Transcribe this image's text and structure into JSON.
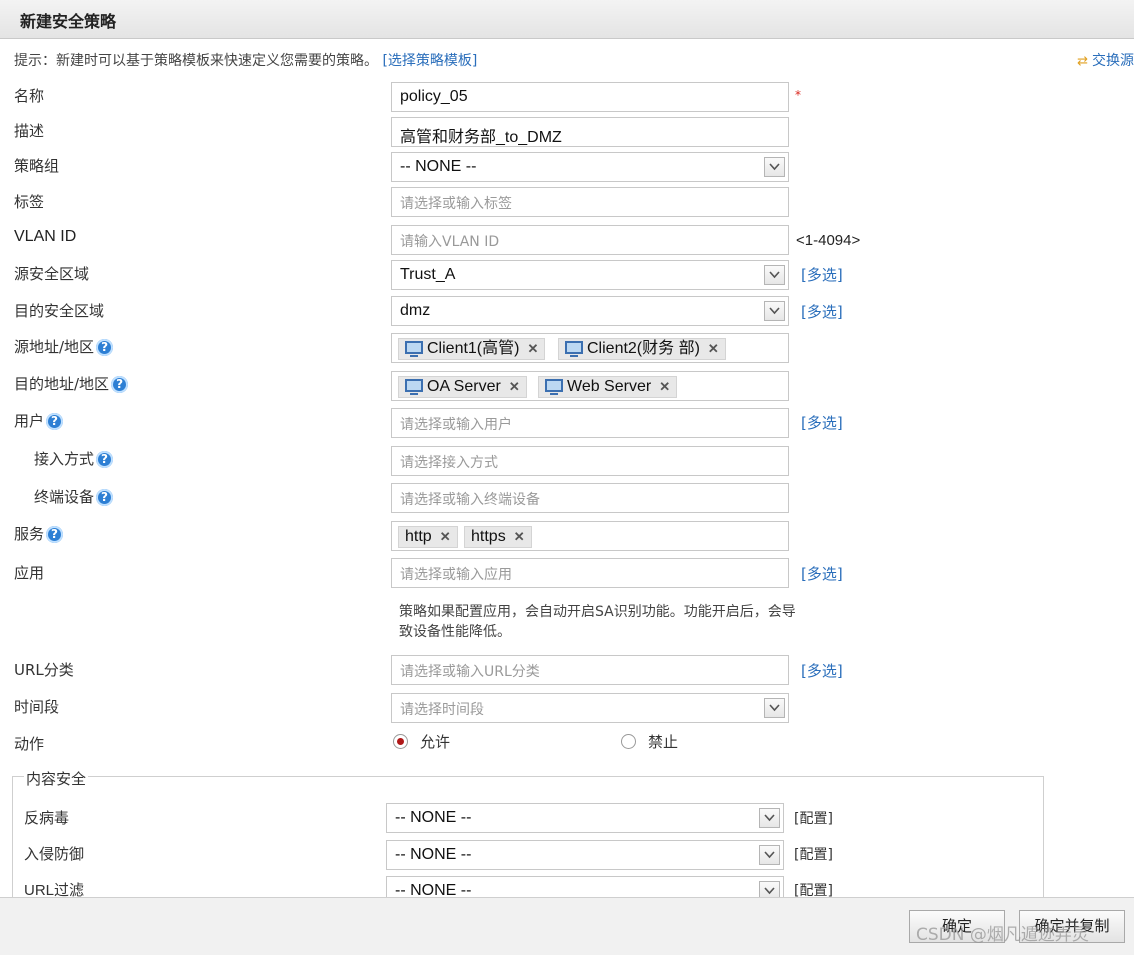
{
  "dialog": {
    "title": "新建安全策略"
  },
  "hint": {
    "text": "提示：新建时可以基于策略模板来快速定义您需要的策略。",
    "link": "[选择策略模板]"
  },
  "swap_label": "交换源",
  "form": {
    "name_label": "名称",
    "name_value": "policy_05",
    "required_mark": "*",
    "desc_label": "描述",
    "desc_value": "高管和财务部_to_DMZ",
    "group_label": "策略组",
    "group_value": "-- NONE --",
    "tag_label": "标签",
    "tag_placeholder": "请选择或输入标签",
    "vlan_label": "VLAN ID",
    "vlan_placeholder": "请输入VLAN ID",
    "vlan_range": "<1-4094>",
    "src_zone_label": "源安全区域",
    "src_zone_value": "Trust_A",
    "dst_zone_label": "目的安全区域",
    "dst_zone_value": "dmz",
    "multi_select": "[多选]",
    "src_addr_label": "源地址/地区",
    "src_addr_tags": [
      "Client1(高管)",
      "Client2(财务 部)"
    ],
    "dst_addr_label": "目的地址/地区",
    "dst_addr_tags": [
      "OA Server",
      "Web Server"
    ],
    "user_label": "用户",
    "user_placeholder": "请选择或输入用户",
    "access_label": "接入方式",
    "access_placeholder": "请选择接入方式",
    "device_label": "终端设备",
    "device_placeholder": "请选择或输入终端设备",
    "service_label": "服务",
    "service_tags": [
      "http",
      "https"
    ],
    "app_label": "应用",
    "app_placeholder": "请选择或输入应用",
    "app_note": "策略如果配置应用，会自动开启SA识别功能。功能开启后，会导致设备性能降低。",
    "url_label": "URL分类",
    "url_placeholder": "请选择或输入URL分类",
    "time_label": "时间段",
    "time_placeholder": "请选择时间段",
    "action_label": "动作",
    "action_allow": "允许",
    "action_deny": "禁止",
    "action_selected": "允许",
    "help_glyph": "?"
  },
  "content_security": {
    "legend": "内容安全",
    "rows": [
      {
        "label": "反病毒",
        "value": "-- NONE --",
        "config": "[配置]"
      },
      {
        "label": "入侵防御",
        "value": "-- NONE --",
        "config": "[配置]"
      },
      {
        "label": "URL过滤",
        "value": "-- NONE --",
        "config": "[配置]"
      }
    ]
  },
  "footer": {
    "ok": "确定",
    "ok_copy": "确定并复制"
  },
  "watermark": "CSDN @烟凡遁迹弄灵"
}
